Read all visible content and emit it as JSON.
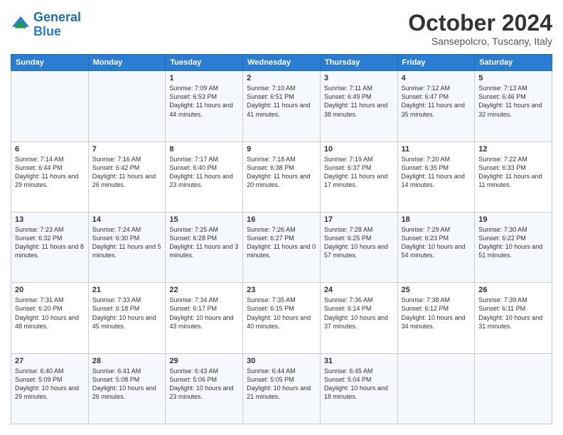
{
  "header": {
    "logo_line1": "General",
    "logo_line2": "Blue",
    "month": "October 2024",
    "location": "Sansepolcro, Tuscany, Italy"
  },
  "weekdays": [
    "Sunday",
    "Monday",
    "Tuesday",
    "Wednesday",
    "Thursday",
    "Friday",
    "Saturday"
  ],
  "weeks": [
    [
      {
        "day": "",
        "sunrise": "",
        "sunset": "",
        "daylight": ""
      },
      {
        "day": "",
        "sunrise": "",
        "sunset": "",
        "daylight": ""
      },
      {
        "day": "1",
        "sunrise": "Sunrise: 7:09 AM",
        "sunset": "Sunset: 6:53 PM",
        "daylight": "Daylight: 11 hours and 44 minutes."
      },
      {
        "day": "2",
        "sunrise": "Sunrise: 7:10 AM",
        "sunset": "Sunset: 6:51 PM",
        "daylight": "Daylight: 11 hours and 41 minutes."
      },
      {
        "day": "3",
        "sunrise": "Sunrise: 7:11 AM",
        "sunset": "Sunset: 6:49 PM",
        "daylight": "Daylight: 11 hours and 38 minutes."
      },
      {
        "day": "4",
        "sunrise": "Sunrise: 7:12 AM",
        "sunset": "Sunset: 6:47 PM",
        "daylight": "Daylight: 11 hours and 35 minutes."
      },
      {
        "day": "5",
        "sunrise": "Sunrise: 7:13 AM",
        "sunset": "Sunset: 6:46 PM",
        "daylight": "Daylight: 11 hours and 32 minutes."
      }
    ],
    [
      {
        "day": "6",
        "sunrise": "Sunrise: 7:14 AM",
        "sunset": "Sunset: 6:44 PM",
        "daylight": "Daylight: 11 hours and 29 minutes."
      },
      {
        "day": "7",
        "sunrise": "Sunrise: 7:16 AM",
        "sunset": "Sunset: 6:42 PM",
        "daylight": "Daylight: 11 hours and 26 minutes."
      },
      {
        "day": "8",
        "sunrise": "Sunrise: 7:17 AM",
        "sunset": "Sunset: 6:40 PM",
        "daylight": "Daylight: 11 hours and 23 minutes."
      },
      {
        "day": "9",
        "sunrise": "Sunrise: 7:18 AM",
        "sunset": "Sunset: 6:38 PM",
        "daylight": "Daylight: 11 hours and 20 minutes."
      },
      {
        "day": "10",
        "sunrise": "Sunrise: 7:19 AM",
        "sunset": "Sunset: 6:37 PM",
        "daylight": "Daylight: 11 hours and 17 minutes."
      },
      {
        "day": "11",
        "sunrise": "Sunrise: 7:20 AM",
        "sunset": "Sunset: 6:35 PM",
        "daylight": "Daylight: 11 hours and 14 minutes."
      },
      {
        "day": "12",
        "sunrise": "Sunrise: 7:22 AM",
        "sunset": "Sunset: 6:33 PM",
        "daylight": "Daylight: 11 hours and 11 minutes."
      }
    ],
    [
      {
        "day": "13",
        "sunrise": "Sunrise: 7:23 AM",
        "sunset": "Sunset: 6:32 PM",
        "daylight": "Daylight: 11 hours and 8 minutes."
      },
      {
        "day": "14",
        "sunrise": "Sunrise: 7:24 AM",
        "sunset": "Sunset: 6:30 PM",
        "daylight": "Daylight: 11 hours and 5 minutes."
      },
      {
        "day": "15",
        "sunrise": "Sunrise: 7:25 AM",
        "sunset": "Sunset: 6:28 PM",
        "daylight": "Daylight: 11 hours and 3 minutes."
      },
      {
        "day": "16",
        "sunrise": "Sunrise: 7:26 AM",
        "sunset": "Sunset: 6:27 PM",
        "daylight": "Daylight: 11 hours and 0 minutes."
      },
      {
        "day": "17",
        "sunrise": "Sunrise: 7:28 AM",
        "sunset": "Sunset: 6:25 PM",
        "daylight": "Daylight: 10 hours and 57 minutes."
      },
      {
        "day": "18",
        "sunrise": "Sunrise: 7:29 AM",
        "sunset": "Sunset: 6:23 PM",
        "daylight": "Daylight: 10 hours and 54 minutes."
      },
      {
        "day": "19",
        "sunrise": "Sunrise: 7:30 AM",
        "sunset": "Sunset: 6:22 PM",
        "daylight": "Daylight: 10 hours and 51 minutes."
      }
    ],
    [
      {
        "day": "20",
        "sunrise": "Sunrise: 7:31 AM",
        "sunset": "Sunset: 6:20 PM",
        "daylight": "Daylight: 10 hours and 48 minutes."
      },
      {
        "day": "21",
        "sunrise": "Sunrise: 7:33 AM",
        "sunset": "Sunset: 6:18 PM",
        "daylight": "Daylight: 10 hours and 45 minutes."
      },
      {
        "day": "22",
        "sunrise": "Sunrise: 7:34 AM",
        "sunset": "Sunset: 6:17 PM",
        "daylight": "Daylight: 10 hours and 43 minutes."
      },
      {
        "day": "23",
        "sunrise": "Sunrise: 7:35 AM",
        "sunset": "Sunset: 6:15 PM",
        "daylight": "Daylight: 10 hours and 40 minutes."
      },
      {
        "day": "24",
        "sunrise": "Sunrise: 7:36 AM",
        "sunset": "Sunset: 6:14 PM",
        "daylight": "Daylight: 10 hours and 37 minutes."
      },
      {
        "day": "25",
        "sunrise": "Sunrise: 7:38 AM",
        "sunset": "Sunset: 6:12 PM",
        "daylight": "Daylight: 10 hours and 34 minutes."
      },
      {
        "day": "26",
        "sunrise": "Sunrise: 7:39 AM",
        "sunset": "Sunset: 6:11 PM",
        "daylight": "Daylight: 10 hours and 31 minutes."
      }
    ],
    [
      {
        "day": "27",
        "sunrise": "Sunrise: 6:40 AM",
        "sunset": "Sunset: 5:09 PM",
        "daylight": "Daylight: 10 hours and 29 minutes."
      },
      {
        "day": "28",
        "sunrise": "Sunrise: 6:41 AM",
        "sunset": "Sunset: 5:08 PM",
        "daylight": "Daylight: 10 hours and 26 minutes."
      },
      {
        "day": "29",
        "sunrise": "Sunrise: 6:43 AM",
        "sunset": "Sunset: 5:06 PM",
        "daylight": "Daylight: 10 hours and 23 minutes."
      },
      {
        "day": "30",
        "sunrise": "Sunrise: 6:44 AM",
        "sunset": "Sunset: 5:05 PM",
        "daylight": "Daylight: 10 hours and 21 minutes."
      },
      {
        "day": "31",
        "sunrise": "Sunrise: 6:45 AM",
        "sunset": "Sunset: 5:04 PM",
        "daylight": "Daylight: 10 hours and 18 minutes."
      },
      {
        "day": "",
        "sunrise": "",
        "sunset": "",
        "daylight": ""
      },
      {
        "day": "",
        "sunrise": "",
        "sunset": "",
        "daylight": ""
      }
    ]
  ]
}
